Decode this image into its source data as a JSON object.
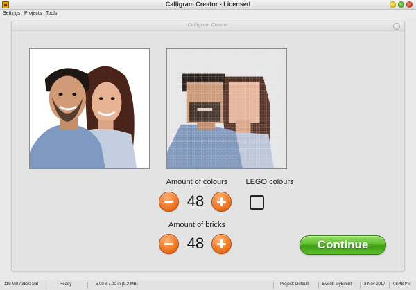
{
  "window": {
    "title": "Calligram Creator - Licensed"
  },
  "menu": {
    "items": [
      "Settings",
      "Projects",
      "Tools"
    ]
  },
  "dialog": {
    "title": "Calligram Creator"
  },
  "colours": {
    "label": "Amount of colours",
    "value": "48"
  },
  "lego": {
    "label": "LEGO colours",
    "checked": false
  },
  "bricks": {
    "label": "Amount of bricks",
    "value": "48"
  },
  "continue_label": "Continue",
  "status": {
    "memory": "119 MB / 3830 MB",
    "state": "Ready",
    "size": "5.00 x 7.00 in  (9.2 MB)",
    "project": "Project: Default",
    "event": "Event: MyEvent",
    "date": "3 Nov 2017",
    "time": "08:48 PM"
  },
  "colors": {
    "accent_orange": "#f07a26",
    "continue_green": "#4aae20"
  }
}
